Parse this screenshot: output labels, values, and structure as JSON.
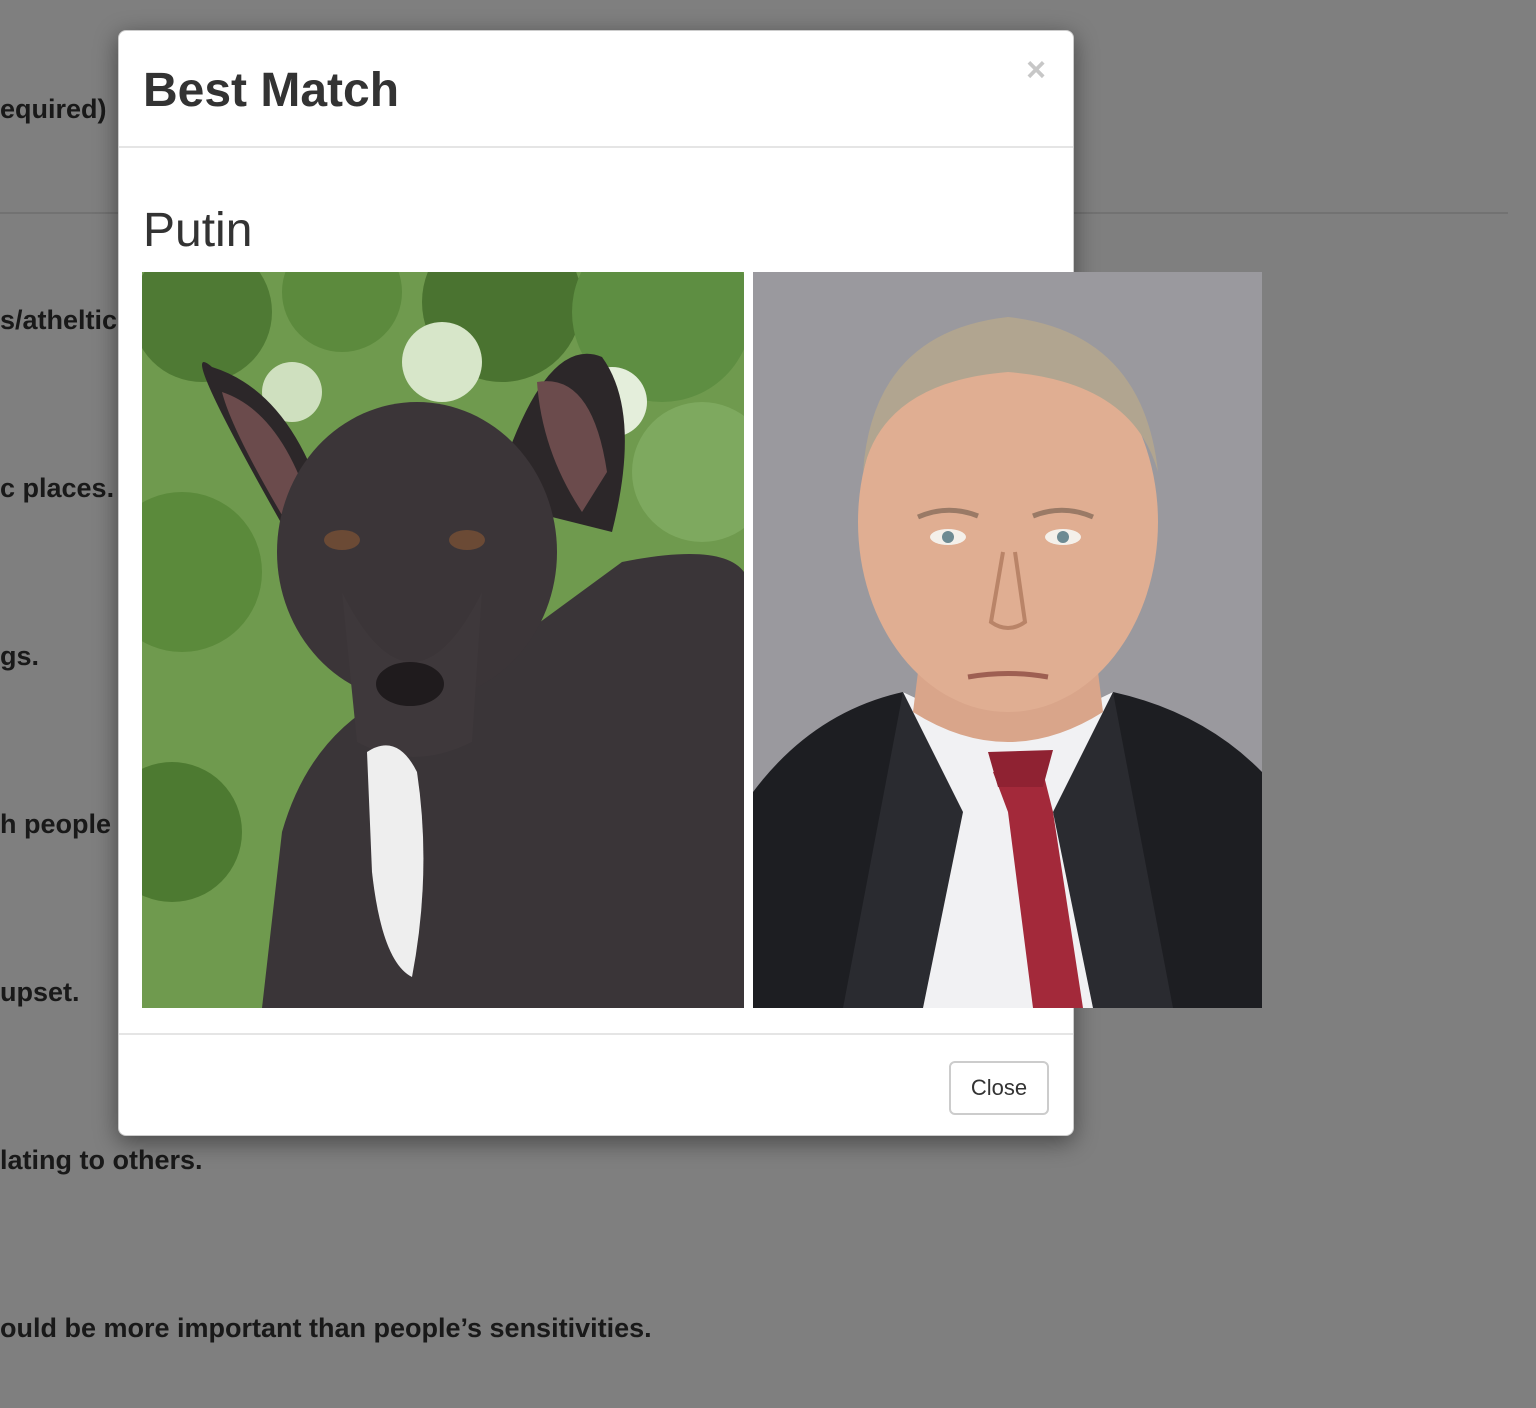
{
  "background": {
    "lines": [
      "equired)",
      "s/atheltic",
      "c places.",
      "gs.",
      "h people",
      "upset.",
      "lating to others.",
      "ould be more important than people’s sensitivities."
    ]
  },
  "modal": {
    "title": "Best Match",
    "close_icon": "×",
    "match_name": "Putin",
    "close_label": "Close",
    "photos": [
      {
        "subject": "dog"
      },
      {
        "subject": "person"
      }
    ]
  },
  "colors": {
    "backdrop": "rgba(0,0,0,0.5)",
    "modal_bg": "#ffffff",
    "text": "#333333",
    "divider": "#e5e5e5",
    "tie": "#a3293a",
    "photo_bg": "#9a999e"
  }
}
